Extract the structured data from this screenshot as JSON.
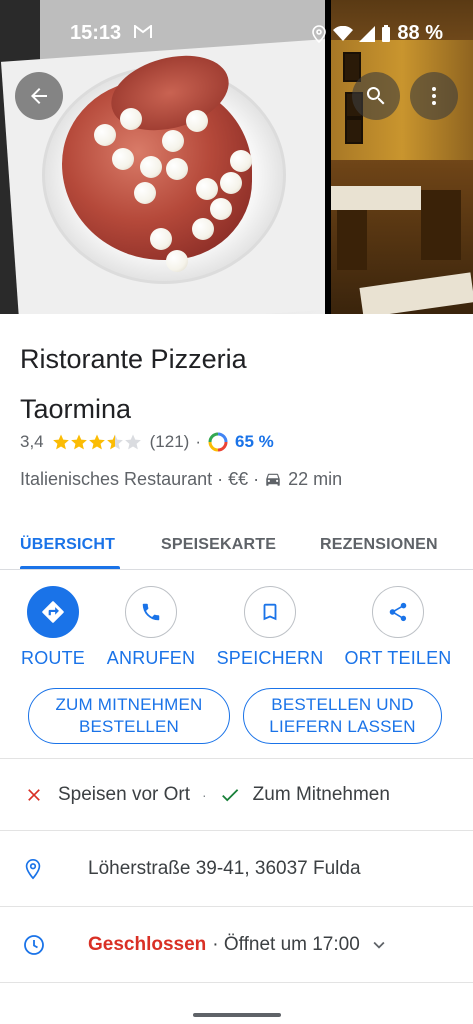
{
  "status_bar": {
    "time": "15:13",
    "battery": "88 %"
  },
  "place": {
    "name_line1": "Ristorante Pizzeria",
    "name_line2": "Taormina",
    "rating": "3,4",
    "stars": 3.4,
    "review_count": "(121)",
    "match_percent": "65 %",
    "category": "Italienisches Restaurant",
    "price": "€€",
    "drive_time": "22 min"
  },
  "tabs": [
    {
      "label": "ÜBERSICHT",
      "active": true
    },
    {
      "label": "SPEISEKARTE",
      "active": false
    },
    {
      "label": "REZENSIONEN",
      "active": false
    }
  ],
  "actions": [
    {
      "label": "ROUTE",
      "icon": "directions-icon"
    },
    {
      "label": "ANRUFEN",
      "icon": "phone-icon"
    },
    {
      "label": "SPEICHERN",
      "icon": "bookmark-icon"
    },
    {
      "label": "ORT TEILEN",
      "icon": "share-icon"
    }
  ],
  "order_buttons": {
    "takeaway_line1": "ZUM MITNEHMEN",
    "takeaway_line2": "BESTELLEN",
    "delivery_line1": "BESTELLEN UND",
    "delivery_line2": "LIEFERN LASSEN"
  },
  "services": {
    "dine_in": "Speisen vor Ort",
    "separator": "·",
    "takeaway": "Zum Mitnehmen"
  },
  "address": "Löherstraße 39-41, 36037 Fulda",
  "hours": {
    "status": "Geschlossen",
    "next": "· Öffnet um 17:00"
  },
  "colors": {
    "accent": "#1a73e8",
    "closed": "#d93025",
    "star": "#fbbc04"
  }
}
